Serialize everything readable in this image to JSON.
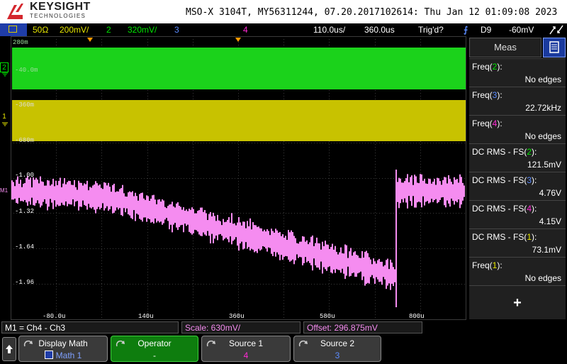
{
  "header": {
    "brand": "KEYSIGHT",
    "brand_sub": "TECHNOLOGIES",
    "info": "MSO-X 3104T, MY56311244, 07.20.2017102614: Thu Jan 12 01:09:08 2023"
  },
  "status": {
    "ch1_impedance": "50Ω",
    "ch1_scale": "200mV/",
    "ch2_num": "2",
    "ch2_scale": "320mV/",
    "ch3_num": "3",
    "ch4_num": "4",
    "timebase": "110.0us/",
    "delay": "360.0us",
    "trig_state": "Trig'd?",
    "trig_source": "D9",
    "trig_level": "-60mV"
  },
  "graticule": {
    "ch2_labels": [
      "280m",
      "-40.0m"
    ],
    "ch1_labels": [
      "-360m",
      "-680m"
    ],
    "math_labels": [
      "-1.00",
      "-1.32",
      "-1.64",
      "-1.96"
    ],
    "time_labels": [
      "-80.0u",
      "140u",
      "360u",
      "580u",
      "800u"
    ],
    "ch1_marker": "1",
    "ch2_marker": "2",
    "math_marker": "M1"
  },
  "measure": {
    "tab_label": "Meas",
    "items": [
      {
        "name_pre": "Freq(",
        "ch": "2",
        "name_post": "):",
        "value": "No edges"
      },
      {
        "name_pre": "Freq(",
        "ch": "3",
        "name_post": "):",
        "value": "22.72kHz"
      },
      {
        "name_pre": "Freq(",
        "ch": "4",
        "name_post": "):",
        "value": "No edges"
      },
      {
        "name_pre": "DC RMS - FS(",
        "ch": "2",
        "name_post": "):",
        "value": "121.5mV"
      },
      {
        "name_pre": "DC RMS - FS(",
        "ch": "3",
        "name_post": "):",
        "value": "4.76V"
      },
      {
        "name_pre": "DC RMS - FS(",
        "ch": "4",
        "name_post": "):",
        "value": "4.15V"
      },
      {
        "name_pre": "DC RMS - FS(",
        "ch": "1",
        "name_post": "):",
        "value": "73.1mV"
      },
      {
        "name_pre": "Freq(",
        "ch": "1",
        "name_post": "):",
        "value": "No edges"
      }
    ],
    "add_symbol": "+"
  },
  "math_info": {
    "expression": "M1 = Ch4 - Ch3",
    "scale": "Scale: 630mV/",
    "offset": "Offset: 296.875mV"
  },
  "softkeys": {
    "display_title": "Display Math",
    "display_value": "Math 1",
    "operator_title": "Operator",
    "operator_value": "-",
    "source1_title": "Source 1",
    "source1_value": "4",
    "source2_title": "Source 2",
    "source2_value": "3"
  },
  "colors": {
    "ch1": "#e6e600",
    "ch2": "#00e600",
    "ch3": "#5b8cff",
    "ch4": "#ff2ad4",
    "math": "#f58cf0",
    "accent_blue": "#1f3da8"
  }
}
